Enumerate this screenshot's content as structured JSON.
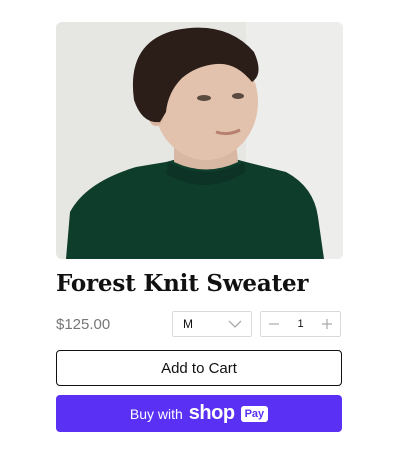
{
  "product": {
    "title": "Forest Knit Sweater",
    "price": "$125.00",
    "image_alt": "woman wearing dark green knit sweater"
  },
  "size_select": {
    "selected": "M",
    "icon": "chevron-down-icon"
  },
  "quantity": {
    "value": "1",
    "minus_icon": "minus-icon",
    "plus_icon": "plus-icon"
  },
  "buttons": {
    "add_to_cart": "Add to Cart",
    "buy_with": "Buy with",
    "shop_logo": "shop",
    "pay_badge": "Pay"
  },
  "colors": {
    "shop_purple": "#5a31f4",
    "sweater_green": "#0f3d2c"
  }
}
